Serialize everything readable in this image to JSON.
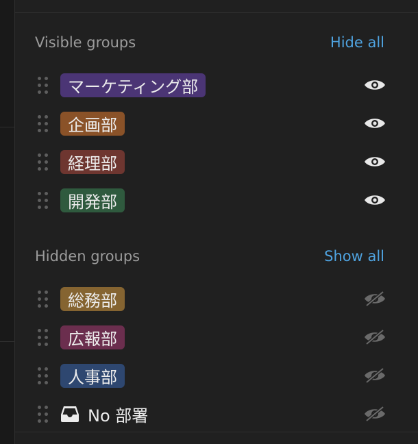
{
  "visible": {
    "title": "Visible groups",
    "action": "Hide all",
    "items": [
      {
        "label": "マーケティング部",
        "color": "#4b3575"
      },
      {
        "label": "企画部",
        "color": "#8a5228"
      },
      {
        "label": "経理部",
        "color": "#6e3630"
      },
      {
        "label": "開発部",
        "color": "#2f5a3e"
      }
    ]
  },
  "hidden": {
    "title": "Hidden groups",
    "action": "Show all",
    "items": [
      {
        "label": "総務部",
        "color": "#856431"
      },
      {
        "label": "広報部",
        "color": "#6b2e4e"
      },
      {
        "label": "人事部",
        "color": "#2e4770"
      }
    ],
    "no_group": {
      "label": "No 部署",
      "icon": "inbox-icon"
    }
  },
  "colors": {
    "accent": "#4fa3e0",
    "eye_visible": "#e8e8e8",
    "eye_hidden": "#6a6a6a"
  }
}
